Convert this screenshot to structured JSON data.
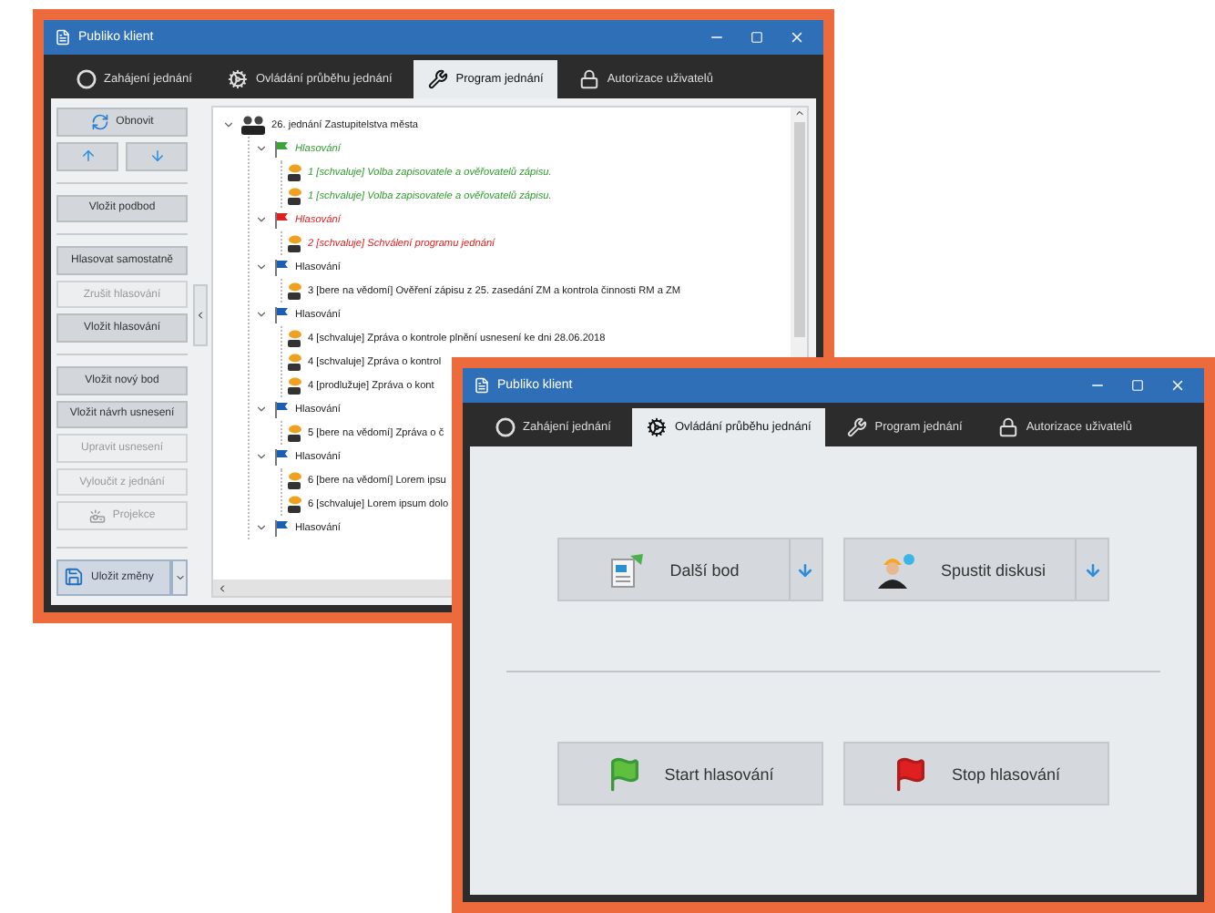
{
  "back_window": {
    "title": "Publiko klient",
    "tabs": [
      {
        "label": "Zahájení jednání",
        "selected": false
      },
      {
        "label": "Ovládání průběhu jednání",
        "selected": false
      },
      {
        "label": "Program jednání",
        "selected": true
      },
      {
        "label": "Autorizace uživatelů",
        "selected": false
      }
    ],
    "left_panel": {
      "refresh_button": "Obnovit",
      "groups": [
        [
          {
            "label": "Vložit podbod",
            "disabled": false
          }
        ],
        [
          {
            "label": "Hlasovat samostatně",
            "disabled": false
          },
          {
            "label": "Zrušit hlasování",
            "disabled": true
          },
          {
            "label": "Vložit hlasování",
            "disabled": false
          }
        ],
        [
          {
            "label": "Vložit nový bod",
            "disabled": false
          },
          {
            "label": "Vložit návrh usnesení",
            "disabled": false
          },
          {
            "label": "Upravit usnesení",
            "disabled": true
          },
          {
            "label": "Vyloučit z jednání",
            "disabled": true
          },
          {
            "label": "Projekce",
            "disabled": true,
            "kind": "projector"
          }
        ]
      ],
      "save_button": "Uložit změny"
    },
    "tree": {
      "label": "26. jednání Zastupitelstva města",
      "expanded": true,
      "children": [
        {
          "label": "Hlasování",
          "color": "#3aa53a",
          "kind": "passed",
          "expanded": true,
          "children": [
            {
              "label": "1 [schvaluje] Volba zapisovatele a ověřovatelů zápisu."
            },
            {
              "label": "1 [schvaluje] Volba zapisovatele a ověřovatelů zápisu."
            }
          ]
        },
        {
          "label": "Hlasování",
          "color": "#e02020",
          "kind": "failed",
          "expanded": true,
          "children": [
            {
              "label": "2 [schvaluje] Schválení programu jednání"
            }
          ]
        },
        {
          "label": "Hlasování",
          "color": "#1a5fb4",
          "kind": "open",
          "expanded": true,
          "children": [
            {
              "label": "3 [bere na vědomí] Ověření zápisu z 25. zasedání ZM a kontrola činnosti RM a ZM"
            }
          ]
        },
        {
          "label": "Hlasování",
          "color": "#1a5fb4",
          "kind": "open",
          "expanded": true,
          "children": [
            {
              "label": "4 [schvaluje] Zpráva o kontrole plnění usnesení ke dni 28.06.2018"
            },
            {
              "label": "4 [schvaluje] Zpráva o kontrol"
            },
            {
              "label": "4 [prodlužuje] Zpráva o kont"
            }
          ]
        },
        {
          "label": "Hlasování",
          "color": "#1a5fb4",
          "kind": "open",
          "expanded": true,
          "children": [
            {
              "label": "5 [bere na vědomí] Zpráva o č"
            }
          ]
        },
        {
          "label": "Hlasování",
          "color": "#1a5fb4",
          "kind": "open",
          "expanded": true,
          "children": [
            {
              "label": "6 [bere na vědomí] Lorem ipsu"
            },
            {
              "label": "6 [schvaluje] Lorem ipsum dolo"
            }
          ]
        },
        {
          "label": "Hlasování",
          "color": "#1a5fb4",
          "kind": "open",
          "expanded": true
        }
      ]
    }
  },
  "front_window": {
    "title": "Publiko klient",
    "tabs": [
      {
        "label": "Zahájení jednání",
        "selected": false
      },
      {
        "label": "Ovládání průběhu jednání",
        "selected": true
      },
      {
        "label": "Program jednání",
        "selected": false
      },
      {
        "label": "Autorizace uživatelů",
        "selected": false
      }
    ],
    "button_rows": [
      [
        {
          "label": "Další bod",
          "dropdown": true
        },
        {
          "label": "Spustit diskusi",
          "dropdown": true
        }
      ],
      [
        {
          "label": "Start hlasování",
          "dropdown": false
        },
        {
          "label": "Stop hlasování",
          "dropdown": false
        }
      ]
    ]
  }
}
